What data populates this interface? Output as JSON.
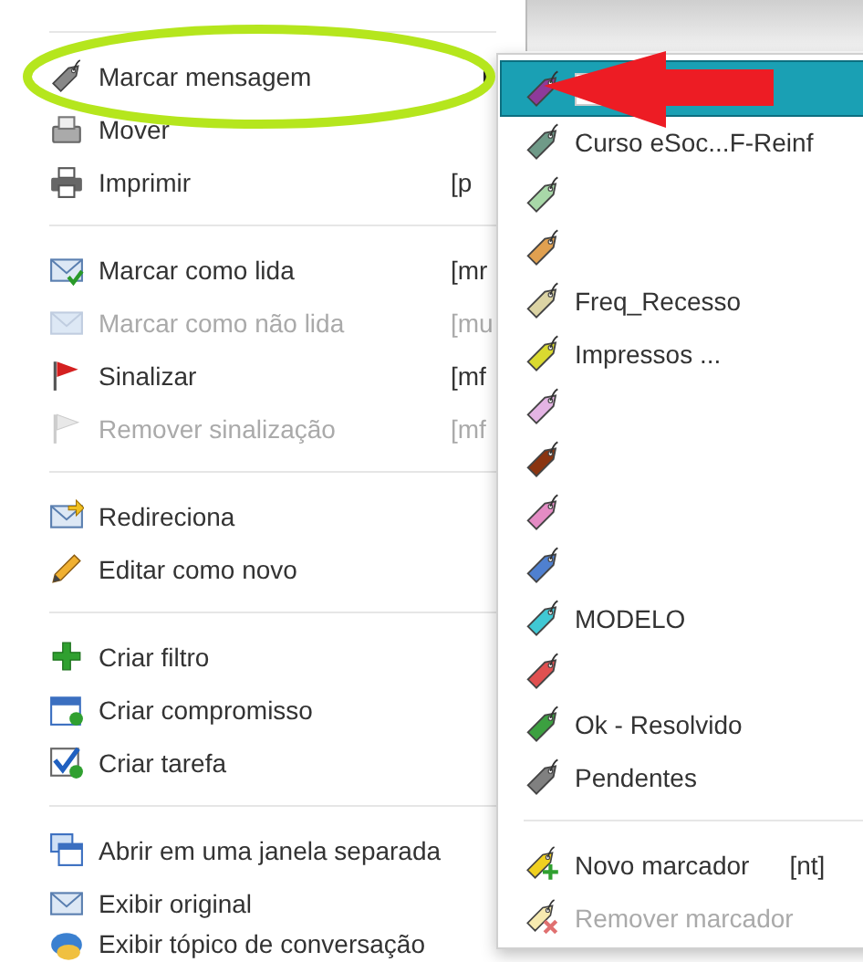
{
  "menu": {
    "items": [
      {
        "kind": "separator"
      },
      {
        "kind": "item",
        "label": "Marcar mensagem",
        "disabled": false,
        "has_submenu": true
      },
      {
        "kind": "item",
        "label": "Mover",
        "disabled": false
      },
      {
        "kind": "item",
        "label": "Imprimir",
        "shortcut": "[p",
        "disabled": false
      },
      {
        "kind": "separator"
      },
      {
        "kind": "item",
        "label": "Marcar como lida",
        "shortcut": "[mr",
        "disabled": false
      },
      {
        "kind": "item",
        "label": "Marcar como não lida",
        "shortcut": "[mu",
        "disabled": true
      },
      {
        "kind": "item",
        "label": "Sinalizar",
        "shortcut": "[mf",
        "disabled": false
      },
      {
        "kind": "item",
        "label": "Remover sinalização",
        "shortcut": "[mf",
        "disabled": true
      },
      {
        "kind": "separator"
      },
      {
        "kind": "item",
        "label": "Redireciona",
        "disabled": false
      },
      {
        "kind": "item",
        "label": "Editar como novo",
        "disabled": false
      },
      {
        "kind": "separator"
      },
      {
        "kind": "item",
        "label": "Criar filtro",
        "disabled": false
      },
      {
        "kind": "item",
        "label": "Criar compromisso",
        "disabled": false
      },
      {
        "kind": "item",
        "label": "Criar tarefa",
        "disabled": false
      },
      {
        "kind": "separator"
      },
      {
        "kind": "item",
        "label": "Abrir em uma janela separada",
        "disabled": false
      },
      {
        "kind": "item",
        "label": "Exibir original",
        "disabled": false
      },
      {
        "kind": "item",
        "label": "Exibir tópico de conversação",
        "disabled": false
      }
    ]
  },
  "submenu": {
    "items": [
      {
        "kind": "tag",
        "color": "#8e3a9a",
        "selected": true,
        "editing": true
      },
      {
        "kind": "tag",
        "label": "Curso eSoc...F-Reinf",
        "color": "#6f9a88",
        "selected": false
      },
      {
        "kind": "tag",
        "color": "#a8d8a8",
        "selected": false
      },
      {
        "kind": "tag",
        "color": "#e0a050",
        "selected": false
      },
      {
        "kind": "tag",
        "label": "Freq_Recesso",
        "color": "#dcd4a4",
        "selected": false
      },
      {
        "kind": "tag",
        "label": "Impressos ...",
        "color": "#dada30",
        "selected": false
      },
      {
        "kind": "tag",
        "color": "#e4b4e4",
        "selected": false
      },
      {
        "kind": "tag",
        "color": "#8a3410",
        "selected": false
      },
      {
        "kind": "tag",
        "color": "#e48cc4",
        "selected": false
      },
      {
        "kind": "tag",
        "color": "#4f80d0",
        "selected": false
      },
      {
        "kind": "tag",
        "label": "MODELO",
        "color": "#40c8d4",
        "selected": false
      },
      {
        "kind": "tag",
        "color": "#e05050",
        "selected": false
      },
      {
        "kind": "tag",
        "label": "Ok - Resolvido",
        "color": "#3ca040",
        "selected": false
      },
      {
        "kind": "tag",
        "label": "Pendentes",
        "color": "#808080",
        "selected": false
      },
      {
        "kind": "separator"
      },
      {
        "kind": "action",
        "label": "Novo marcador",
        "shortcut": "[nt]",
        "disabled": false
      },
      {
        "kind": "action",
        "label": "Remover marcador",
        "disabled": true
      }
    ]
  },
  "annotations": {
    "ellipse": true,
    "arrow": true
  }
}
